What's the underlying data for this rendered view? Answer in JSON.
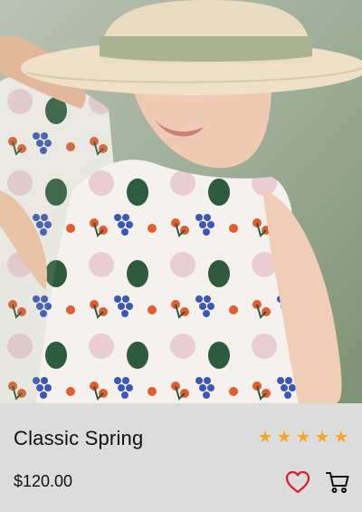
{
  "product": {
    "title": "Classic Spring",
    "price": "$120.00",
    "rating": 5,
    "rating_max": 5
  },
  "icons": {
    "star": "star-icon",
    "favorite": "heart-icon",
    "cart": "cart-icon"
  },
  "colors": {
    "star": "#f5a623",
    "heart": "#e0192a",
    "panel": "#dcdcdc"
  }
}
